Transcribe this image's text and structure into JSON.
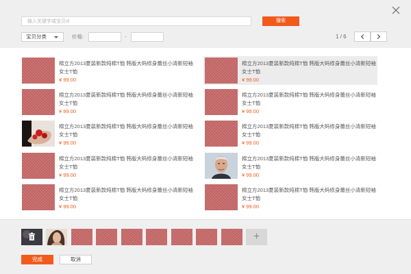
{
  "toolbar": {
    "search_placeholder": "输入关键字或宝贝id",
    "search_label": "搜索",
    "category_label": "宝贝分类",
    "price_label": "价格:",
    "price_min": "",
    "price_max": "",
    "price_sep": "-",
    "page_indicator": "1 / 6"
  },
  "colors": {
    "accent": "#f25a1d",
    "placeholder_thumb": "#c76a6a",
    "selected_row_bg": "#ececec"
  },
  "items": [
    {
      "title": "棉立方2013夏装新款纯棉T恤 韩版大码修身蕾丝小清新短袖女士T恤",
      "price": "¥ 99.00",
      "image": "placeholder",
      "selected": false
    },
    {
      "title": "棉立方2013夏装新款纯棉T恤 韩版大码修身蕾丝小清新短袖女士T恤",
      "price": "¥ 99.00",
      "image": "placeholder",
      "selected": true
    },
    {
      "title": "棉立方2013夏装新款纯棉T恤 韩版大码修身蕾丝小清新短袖女士T恤",
      "price": "¥ 99.00",
      "image": "placeholder",
      "selected": false
    },
    {
      "title": "棉立方2013夏装新款纯棉T恤 韩版大码修身蕾丝小清新短袖女士T恤",
      "price": "¥ 99.00",
      "image": "placeholder",
      "selected": false
    },
    {
      "title": "棉立方2013夏装新款纯棉T恤 韩版大码修身蕾丝小清新短袖女士T恤",
      "price": "¥ 99.00",
      "image": "photo-red-pills",
      "selected": false
    },
    {
      "title": "棉立方2013夏装新款纯棉T恤 韩版大码修身蕾丝小清新短袖女士T恤",
      "price": "¥ 99.00",
      "image": "placeholder",
      "selected": false
    },
    {
      "title": "棉立方2013夏装新款纯棉T恤 韩版大码修身蕾丝小清新短袖女士T恤",
      "price": "¥ 99.00",
      "image": "placeholder",
      "selected": false
    },
    {
      "title": "棉立方2013夏装新款纯棉T恤 韩版大码修身蕾丝小清新短袖女士T恤",
      "price": "¥ 99.00",
      "image": "photo-man-portrait",
      "selected": false
    },
    {
      "title": "棉立方2013夏装新款纯棉T恤 韩版大码修身蕾丝小清新短袖女士T恤",
      "price": "¥ 99.00",
      "image": "placeholder",
      "selected": false
    },
    {
      "title": "棉立方2013夏装新款纯棉T恤 韩版大码修身蕾丝小清新短袖女士T恤",
      "price": "¥ 99.00",
      "image": "placeholder",
      "selected": false
    }
  ],
  "selected_strip": {
    "thumbs": [
      "photo-with-trash-icon",
      "photo-woman-portrait",
      "placeholder",
      "placeholder",
      "placeholder",
      "placeholder",
      "placeholder",
      "placeholder",
      "placeholder"
    ],
    "add_label": "+"
  },
  "footer": {
    "done_label": "完成",
    "cancel_label": "取消"
  },
  "icons": [
    "close-icon",
    "chevron-down-icon",
    "chevron-left-icon",
    "chevron-right-icon",
    "trash-icon",
    "plus-icon"
  ]
}
